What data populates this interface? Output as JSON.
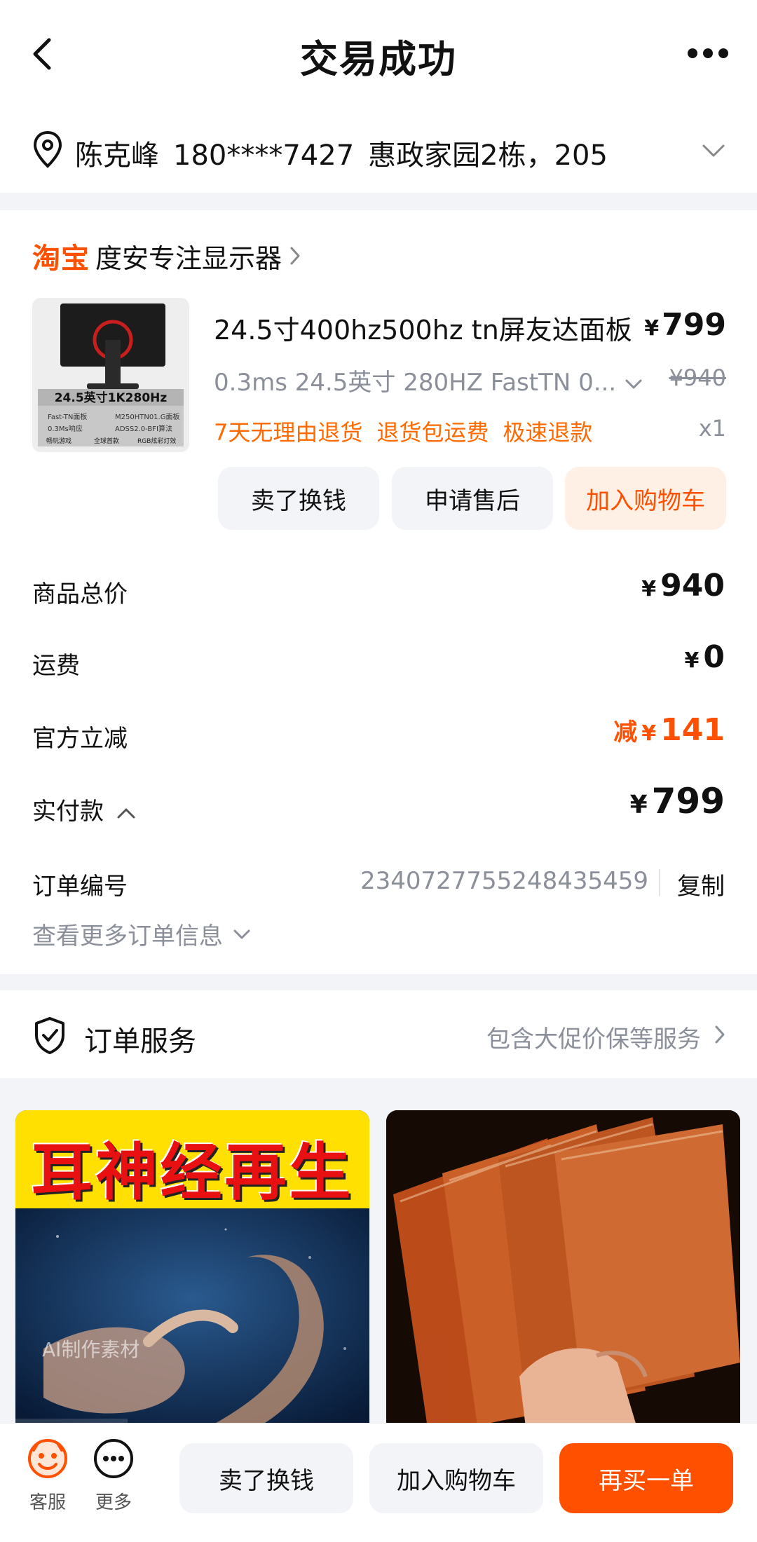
{
  "header": {
    "title": "交易成功"
  },
  "address": {
    "name": "陈克峰",
    "phone": "180****7427",
    "detail": "惠政家园2栋，205"
  },
  "shop": {
    "logo": "淘宝",
    "name": "度安专注显示器"
  },
  "product": {
    "thumb_line1": "24.5英寸1K280Hz",
    "thumb_spec_left": [
      "Fast-TN面板",
      "0.3Ms响应"
    ],
    "thumb_spec_right": [
      "M250HTN01.G面板",
      "ADSS2.0-BFI算法"
    ],
    "thumb_tags": [
      "畅玩游戏",
      "全球首款",
      "RGB炫彩灯效"
    ],
    "title": "24.5寸400hz500hz tn屏友达面板",
    "spec": "0.3ms 24.5英寸 280HZ FastTN 0...",
    "price_symbol": "¥",
    "price": "799",
    "original_price": "¥940",
    "tags": [
      "7天无理由退货",
      "退货包运费",
      "极速退款"
    ],
    "quantity": "x1"
  },
  "actions": {
    "sell": "卖了换钱",
    "after_sale": "申请售后",
    "add_cart": "加入购物车"
  },
  "summary": {
    "subtotal_label": "商品总价",
    "subtotal": "940",
    "shipping_label": "运费",
    "shipping": "0",
    "discount_label": "官方立减",
    "discount_prefix": "减",
    "discount": "141",
    "paid_label": "实付款",
    "paid": "799",
    "yen": "¥"
  },
  "order": {
    "number_label": "订单编号",
    "number": "2340727755248435459",
    "copy": "复制",
    "more": "查看更多订单信息"
  },
  "services": {
    "title": "订单服务",
    "desc": "包含大促价保等服务"
  },
  "recommend": {
    "card1_title": "耳神经再生",
    "card1_watermark": "AI制作素材"
  },
  "bottom": {
    "service": "客服",
    "more": "更多",
    "sell": "卖了换钱",
    "add_cart": "加入购物车",
    "rebuy": "再买一单"
  },
  "colors": {
    "accent": "#ff5000",
    "tag": "#ff6a00",
    "muted": "#8a8f99"
  }
}
